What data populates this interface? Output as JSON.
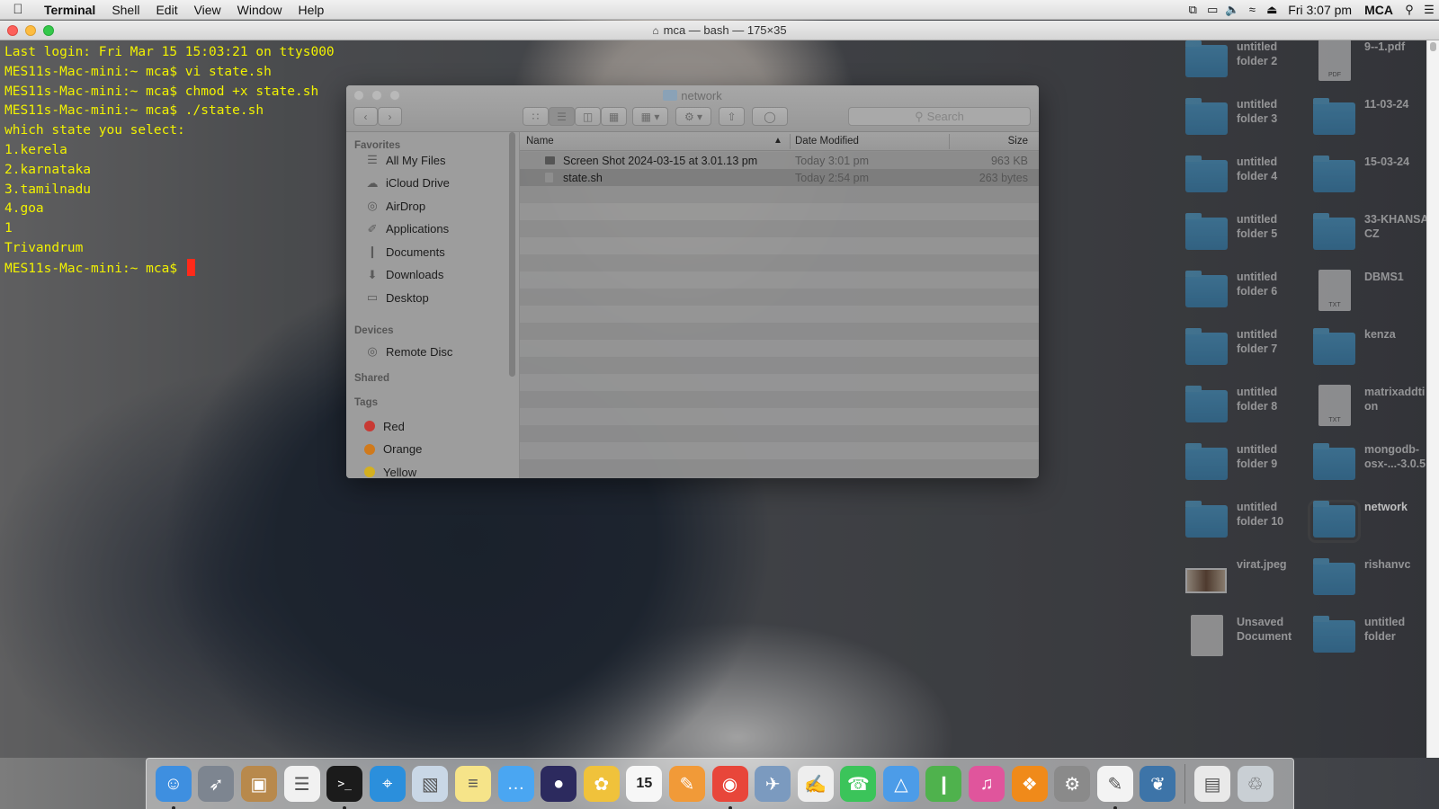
{
  "menubar": {
    "app_name": "Terminal",
    "items": [
      "Shell",
      "Edit",
      "View",
      "Window",
      "Help"
    ],
    "clock": "Fri 3:07 pm",
    "user": "MCA"
  },
  "terminal": {
    "title": "mca — bash — 175×35",
    "lines": [
      "Last login: Fri Mar 15 15:03:21 on ttys000",
      "MES11s-Mac-mini:~ mca$ vi state.sh",
      "MES11s-Mac-mini:~ mca$ chmod +x state.sh",
      "MES11s-Mac-mini:~ mca$ ./state.sh",
      "which state you select:",
      "1.kerela",
      "2.karnataka",
      "3.tamilnadu",
      "4.goa",
      "1",
      "Trivandrum"
    ],
    "prompt": "MES11s-Mac-mini:~ mca$ ",
    "text_color": "#f2f200",
    "cursor_color": "#ff2a1a"
  },
  "finder": {
    "title": "network",
    "search_placeholder": "Search",
    "sidebar": {
      "favorites_heading": "Favorites",
      "favorites": [
        {
          "label": "All My Files",
          "icon": "all-files-icon"
        },
        {
          "label": "iCloud Drive",
          "icon": "cloud-icon"
        },
        {
          "label": "AirDrop",
          "icon": "airdrop-icon"
        },
        {
          "label": "Applications",
          "icon": "applications-icon"
        },
        {
          "label": "Documents",
          "icon": "documents-icon"
        },
        {
          "label": "Downloads",
          "icon": "downloads-icon"
        },
        {
          "label": "Desktop",
          "icon": "desktop-icon"
        }
      ],
      "devices_heading": "Devices",
      "devices": [
        {
          "label": "Remote Disc",
          "icon": "disc-icon"
        }
      ],
      "shared_heading": "Shared",
      "tags_heading": "Tags",
      "tags": [
        {
          "label": "Red",
          "color": "#c83a34"
        },
        {
          "label": "Orange",
          "color": "#d07a1c"
        },
        {
          "label": "Yellow",
          "color": "#d4b020"
        }
      ]
    },
    "columns": {
      "name": "Name",
      "date": "Date Modified",
      "size": "Size"
    },
    "files": [
      {
        "name": "Screen Shot 2024-03-15 at 3.01.13 pm",
        "date": "Today 3:01 pm",
        "size": "963 KB"
      },
      {
        "name": "state.sh",
        "date": "Today 2:54 pm",
        "size": "263 bytes"
      }
    ]
  },
  "desktop": {
    "icons": [
      {
        "label": "untitled\nfolder 2",
        "kind": "folder"
      },
      {
        "label": "9--1.pdf",
        "kind": "pdf"
      },
      {
        "label": "untitled\nfolder 3",
        "kind": "folder"
      },
      {
        "label": "11-03-24",
        "kind": "folder"
      },
      {
        "label": "untitled\nfolder 4",
        "kind": "folder"
      },
      {
        "label": "15-03-24",
        "kind": "folder"
      },
      {
        "label": "untitled\nfolder 5",
        "kind": "folder"
      },
      {
        "label": "33-KHANSA\nCZ",
        "kind": "folder"
      },
      {
        "label": "untitled\nfolder 6",
        "kind": "folder"
      },
      {
        "label": "DBMS1",
        "kind": "txt"
      },
      {
        "label": "untitled\nfolder 7",
        "kind": "folder"
      },
      {
        "label": "kenza",
        "kind": "folder"
      },
      {
        "label": "untitled\nfolder 8",
        "kind": "folder"
      },
      {
        "label": "matrixaddti\non",
        "kind": "txt"
      },
      {
        "label": "untitled\nfolder 9",
        "kind": "folder"
      },
      {
        "label": "mongodb-\nosx-...-3.0.5",
        "kind": "folder"
      },
      {
        "label": "untitled\nfolder 10",
        "kind": "folder"
      },
      {
        "label": "network",
        "kind": "folder"
      },
      {
        "label": "virat.jpeg",
        "kind": "image"
      },
      {
        "label": "rishanvc",
        "kind": "folder"
      },
      {
        "label": "Unsaved\nDocument",
        "kind": "doc"
      },
      {
        "label": "untitled\nfolder",
        "kind": "folder"
      }
    ],
    "selected": "network"
  },
  "dock": {
    "apps": [
      {
        "name": "finder-icon",
        "color": "#3e8fe0",
        "running": true
      },
      {
        "name": "launchpad-icon",
        "color": "#7d8590",
        "running": false
      },
      {
        "name": "contacts-icon",
        "color": "#b8894c",
        "running": false
      },
      {
        "name": "reminders-icon",
        "color": "#f1f1f1",
        "running": false
      },
      {
        "name": "terminal-icon",
        "color": "#1b1b1b",
        "running": true
      },
      {
        "name": "safari-icon",
        "color": "#2b8fdc",
        "running": false
      },
      {
        "name": "preview-icon",
        "color": "#c9d7e6",
        "running": false
      },
      {
        "name": "notes-icon",
        "color": "#f6e489",
        "running": false
      },
      {
        "name": "messages-icon",
        "color": "#4aa6f2",
        "running": false
      },
      {
        "name": "eclipse-icon",
        "color": "#2c2a5e",
        "running": false
      },
      {
        "name": "photos-icon",
        "color": "#f0c23b",
        "running": false
      },
      {
        "name": "calendar-icon",
        "color": "#f7f7f7",
        "running": false
      },
      {
        "name": "pages-icon",
        "color": "#f19a38",
        "running": false
      },
      {
        "name": "chrome-icon",
        "color": "#e8463a",
        "running": true
      },
      {
        "name": "preview-bird-icon",
        "color": "#7b9abf",
        "running": false
      },
      {
        "name": "textedit-icon",
        "color": "#eeeeee",
        "running": false
      },
      {
        "name": "facetime-icon",
        "color": "#3bc45a",
        "running": false
      },
      {
        "name": "keynote-icon",
        "color": "#4c9ce8",
        "running": false
      },
      {
        "name": "numbers-icon",
        "color": "#4fb24d",
        "running": false
      },
      {
        "name": "itunes-icon",
        "color": "#e0559c",
        "running": false
      },
      {
        "name": "ibooks-icon",
        "color": "#f08a1a",
        "running": false
      },
      {
        "name": "system-preferences-icon",
        "color": "#8a8a8a",
        "running": false
      },
      {
        "name": "textedit-pen-icon",
        "color": "#f3f3f3",
        "running": true
      },
      {
        "name": "python-icon",
        "color": "#3d74a8",
        "running": false
      },
      {
        "name": "downloads-stack-icon",
        "color": "#e9e9e9",
        "running": false
      },
      {
        "name": "trash-icon",
        "color": "#c9cfd4",
        "running": false
      }
    ]
  }
}
